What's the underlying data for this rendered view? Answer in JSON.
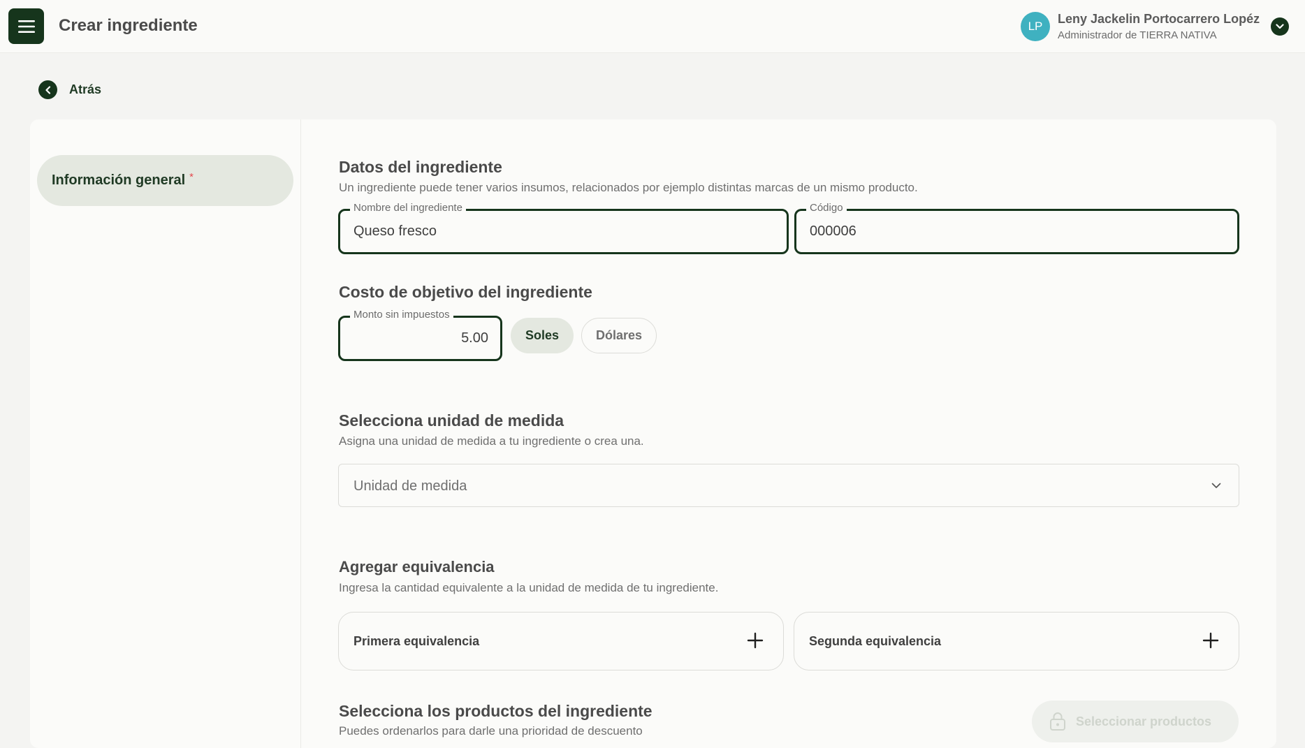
{
  "header": {
    "title": "Crear ingrediente",
    "user": {
      "initials": "LP",
      "name": "Leny Jackelin Portocarrero Lopéz",
      "role": "Administrador de TIERRA NATIVA"
    }
  },
  "nav": {
    "back_label": "Atrás"
  },
  "sidebar": {
    "items": [
      {
        "label": "Información general",
        "required_mark": "*"
      }
    ]
  },
  "ingredient_data": {
    "title": "Datos del ingrediente",
    "description": "Un ingrediente puede tener varios insumos, relacionados por ejemplo distintas marcas de un mismo producto.",
    "name_field": {
      "label": "Nombre del ingrediente",
      "value": "Queso fresco"
    },
    "code_field": {
      "label": "Código",
      "value": "000006"
    }
  },
  "target_cost": {
    "title": "Costo de objetivo del ingrediente",
    "amount_field": {
      "label": "Monto sin impuestos",
      "value": "5.00"
    },
    "currencies": [
      {
        "label": "Soles",
        "selected": true
      },
      {
        "label": "Dólares",
        "selected": false
      }
    ]
  },
  "unit": {
    "title": "Selecciona unidad de medida",
    "description": "Asigna una unidad de medida a tu ingrediente o crea una.",
    "select_placeholder": "Unidad de medida"
  },
  "equivalence": {
    "title": "Agregar equivalencia",
    "description": "Ingresa la cantidad equivalente a la unidad de medida de tu ingrediente.",
    "first_label": "Primera equivalencia",
    "second_label": "Segunda equivalencia"
  },
  "products": {
    "title": "Selecciona los productos del ingrediente",
    "description": "Puedes ordenarlos para darle una prioridad de descuento",
    "button_label": "Seleccionar productos"
  },
  "colors": {
    "brand_dark": "#16351c",
    "accent_light": "#e4e8e0",
    "avatar": "#3fb1c0",
    "required": "#e5484d"
  },
  "icons": {
    "menu": "hamburger-menu-icon",
    "user_dropdown": "chevron-down-icon",
    "back": "chevron-left-icon",
    "select": "chevron-down-icon",
    "add": "plus-icon",
    "products_button": "lock-icon"
  }
}
